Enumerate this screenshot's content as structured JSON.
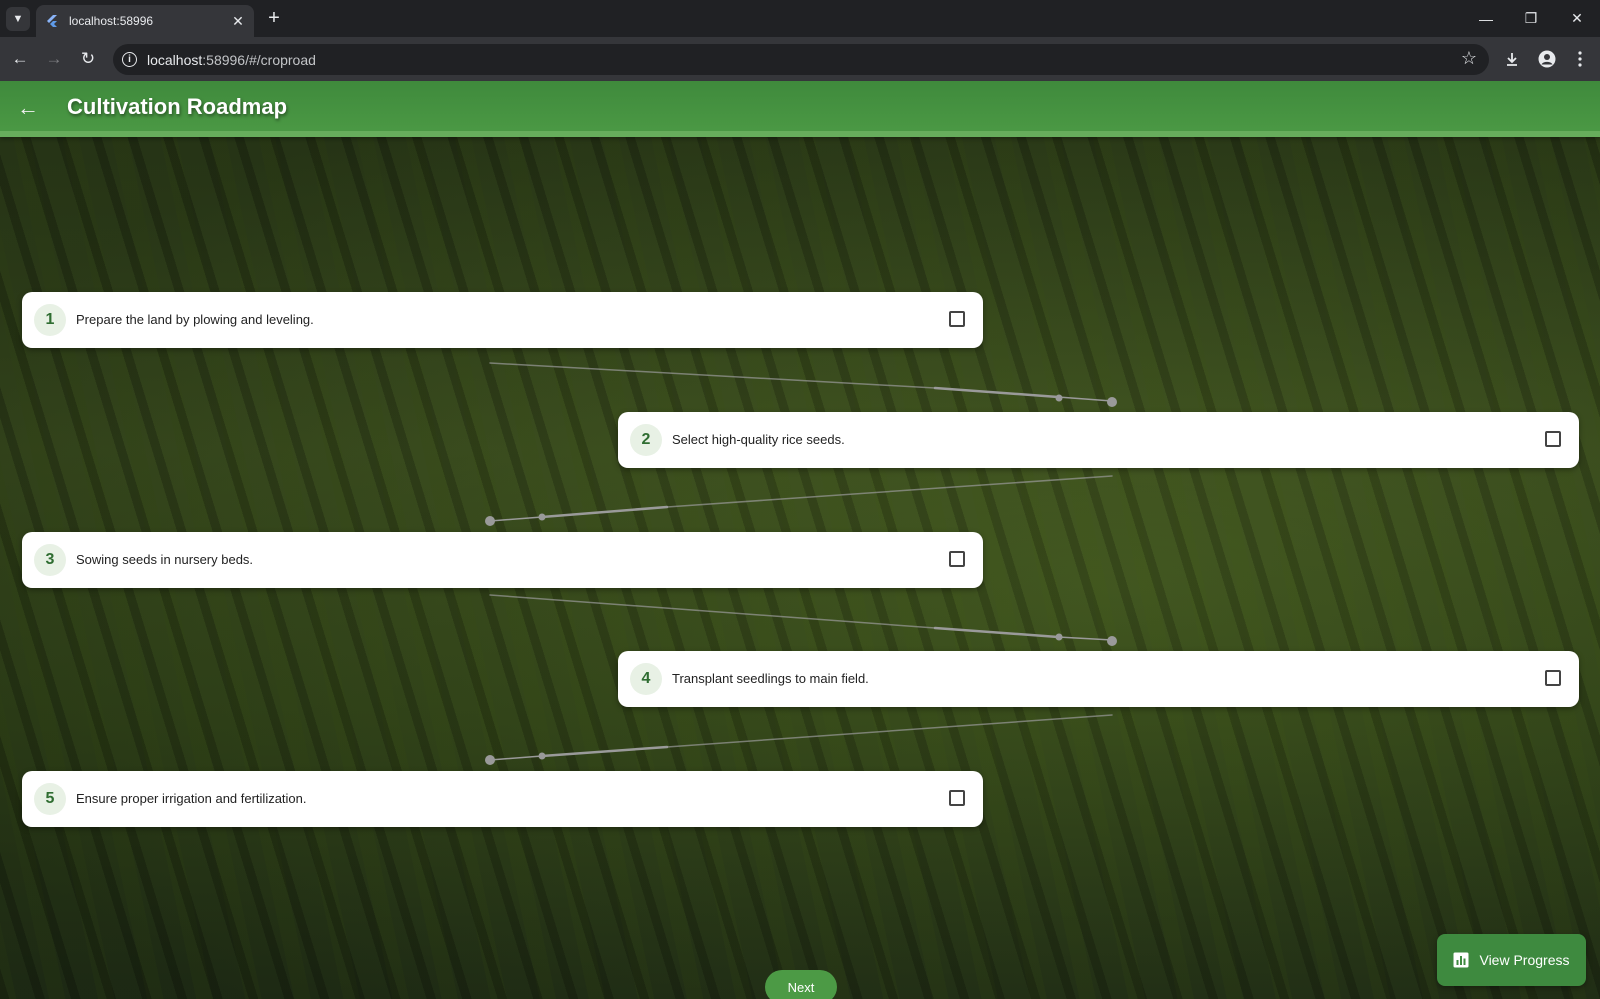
{
  "browser": {
    "tab_title": "localhost:58996",
    "url_host": "localhost",
    "url_rest": ":58996/#/croproad"
  },
  "app": {
    "title": "Cultivation Roadmap"
  },
  "steps": [
    {
      "number": "1",
      "text": "Prepare the land by plowing and leveling.",
      "checked": false
    },
    {
      "number": "2",
      "text": "Select high-quality rice seeds.",
      "checked": false
    },
    {
      "number": "3",
      "text": "Sowing seeds in nursery beds.",
      "checked": false
    },
    {
      "number": "4",
      "text": "Transplant seedlings to main field.",
      "checked": false
    },
    {
      "number": "5",
      "text": "Ensure proper irrigation and fertilization.",
      "checked": false
    }
  ],
  "buttons": {
    "next_label": "Next",
    "view_progress_label": "View Progress"
  },
  "colors": {
    "appbar_green": "#4c9a45",
    "accent_green": "#3e8a3f",
    "step_number_bg": "#e8f1e5"
  }
}
